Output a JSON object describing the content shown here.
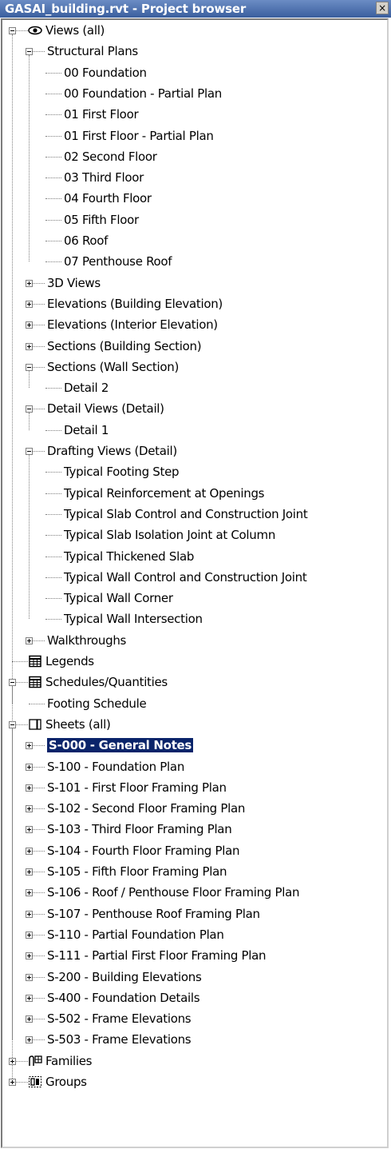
{
  "window": {
    "title": "GASAI_building.rvt - Project browser",
    "close_glyph": "×"
  },
  "icons": {
    "views": "eye-icon",
    "legends": "table-icon",
    "schedules": "table-icon",
    "sheets": "sheet-icon",
    "families": "families-icon",
    "groups": "groups-icon"
  },
  "tree": [
    {
      "label": "Views (all)",
      "level": 0,
      "toggle": "minus",
      "icon": "eye",
      "name": "views-all"
    },
    {
      "label": "Structural Plans",
      "level": 1,
      "toggle": "minus",
      "name": "structural-plans"
    },
    {
      "label": "00 Foundation",
      "level": 2,
      "name": "view"
    },
    {
      "label": "00 Foundation - Partial Plan",
      "level": 2,
      "name": "view"
    },
    {
      "label": "01 First Floor",
      "level": 2,
      "name": "view"
    },
    {
      "label": "01 First Floor - Partial Plan",
      "level": 2,
      "name": "view"
    },
    {
      "label": "02 Second Floor",
      "level": 2,
      "name": "view"
    },
    {
      "label": "03 Third Floor",
      "level": 2,
      "name": "view"
    },
    {
      "label": "04 Fourth Floor",
      "level": 2,
      "name": "view"
    },
    {
      "label": "05 Fifth Floor",
      "level": 2,
      "name": "view"
    },
    {
      "label": "06 Roof",
      "level": 2,
      "name": "view"
    },
    {
      "label": "07 Penthouse Roof",
      "level": 2,
      "name": "view"
    },
    {
      "label": "3D Views",
      "level": 1,
      "toggle": "plus",
      "name": "3d-views"
    },
    {
      "label": "Elevations (Building Elevation)",
      "level": 1,
      "toggle": "plus",
      "name": "elevations-building"
    },
    {
      "label": "Elevations (Interior Elevation)",
      "level": 1,
      "toggle": "plus",
      "name": "elevations-interior"
    },
    {
      "label": "Sections (Building Section)",
      "level": 1,
      "toggle": "plus",
      "name": "sections-building"
    },
    {
      "label": "Sections (Wall Section)",
      "level": 1,
      "toggle": "minus",
      "name": "sections-wall"
    },
    {
      "label": "Detail 2",
      "level": 2,
      "name": "view"
    },
    {
      "label": "Detail Views (Detail)",
      "level": 1,
      "toggle": "minus",
      "name": "detail-views"
    },
    {
      "label": "Detail 1",
      "level": 2,
      "name": "view"
    },
    {
      "label": "Drafting Views (Detail)",
      "level": 1,
      "toggle": "minus",
      "name": "drafting-views"
    },
    {
      "label": "Typical Footing Step",
      "level": 2,
      "name": "view"
    },
    {
      "label": "Typical Reinforcement at Openings",
      "level": 2,
      "name": "view"
    },
    {
      "label": "Typical Slab Control and Construction Joint",
      "level": 2,
      "name": "view"
    },
    {
      "label": "Typical Slab Isolation Joint at Column",
      "level": 2,
      "name": "view"
    },
    {
      "label": "Typical Thickened Slab",
      "level": 2,
      "name": "view"
    },
    {
      "label": "Typical Wall Control and Construction Joint",
      "level": 2,
      "name": "view"
    },
    {
      "label": "Typical Wall Corner",
      "level": 2,
      "name": "view"
    },
    {
      "label": "Typical Wall Intersection",
      "level": 2,
      "name": "view"
    },
    {
      "label": "Walkthroughs",
      "level": 1,
      "toggle": "plus",
      "name": "walkthroughs"
    },
    {
      "label": "Legends",
      "level": 0,
      "icon": "table",
      "name": "legends"
    },
    {
      "label": "Schedules/Quantities",
      "level": 0,
      "toggle": "minus",
      "icon": "table",
      "name": "schedules-quantities"
    },
    {
      "label": "Footing Schedule",
      "level": 1,
      "name": "schedule"
    },
    {
      "label": "Sheets (all)",
      "level": 0,
      "toggle": "minus",
      "icon": "sheet",
      "name": "sheets-all"
    },
    {
      "label": "S-000 - General Notes",
      "level": 1,
      "toggle": "plus",
      "selected": true,
      "name": "sheet"
    },
    {
      "label": "S-100 - Foundation Plan",
      "level": 1,
      "toggle": "plus",
      "name": "sheet"
    },
    {
      "label": "S-101 - First Floor Framing Plan",
      "level": 1,
      "toggle": "plus",
      "name": "sheet"
    },
    {
      "label": "S-102 - Second Floor Framing Plan",
      "level": 1,
      "toggle": "plus",
      "name": "sheet"
    },
    {
      "label": "S-103 - Third Floor Framing Plan",
      "level": 1,
      "toggle": "plus",
      "name": "sheet"
    },
    {
      "label": "S-104 - Fourth Floor Framing Plan",
      "level": 1,
      "toggle": "plus",
      "name": "sheet"
    },
    {
      "label": "S-105 - Fifth Floor Framing Plan",
      "level": 1,
      "toggle": "plus",
      "name": "sheet"
    },
    {
      "label": "S-106 - Roof / Penthouse Floor Framing Plan",
      "level": 1,
      "toggle": "plus",
      "name": "sheet"
    },
    {
      "label": "S-107 - Penthouse Roof Framing Plan",
      "level": 1,
      "toggle": "plus",
      "name": "sheet"
    },
    {
      "label": "S-110 - Partial Foundation Plan",
      "level": 1,
      "toggle": "plus",
      "name": "sheet"
    },
    {
      "label": "S-111 - Partial First Floor Framing Plan",
      "level": 1,
      "toggle": "plus",
      "name": "sheet"
    },
    {
      "label": "S-200 - Building Elevations",
      "level": 1,
      "toggle": "plus",
      "name": "sheet"
    },
    {
      "label": "S-400 - Foundation Details",
      "level": 1,
      "toggle": "plus",
      "name": "sheet"
    },
    {
      "label": "S-502 - Frame Elevations",
      "level": 1,
      "toggle": "plus",
      "name": "sheet"
    },
    {
      "label": "S-503 - Frame Elevations",
      "level": 1,
      "toggle": "plus",
      "name": "sheet"
    },
    {
      "label": "Families",
      "level": 0,
      "toggle": "plus",
      "icon": "families",
      "name": "families"
    },
    {
      "label": "Groups",
      "level": 0,
      "toggle": "plus",
      "icon": "groups",
      "name": "groups"
    }
  ],
  "colors": {
    "title_bg": "#3a5f9e",
    "selection_bg": "#0a246a",
    "selection_text": "#ffffff",
    "tree_lines": "#808080"
  }
}
